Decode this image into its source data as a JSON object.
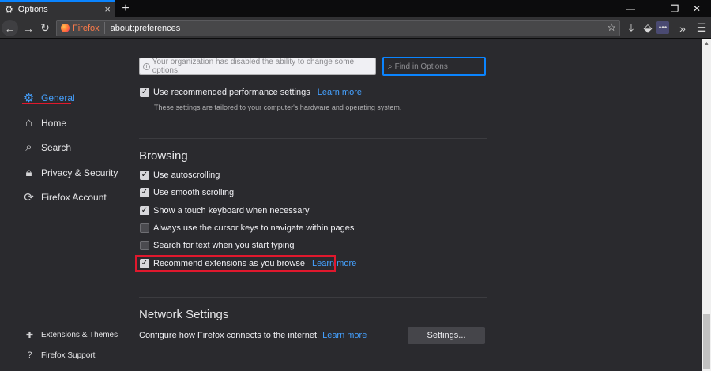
{
  "tab": {
    "title": "Options"
  },
  "navbar": {
    "identity_label": "Firefox",
    "url": "about:preferences"
  },
  "sidebar": {
    "categories": [
      {
        "label": "General"
      },
      {
        "label": "Home"
      },
      {
        "label": "Search"
      },
      {
        "label": "Privacy & Security"
      },
      {
        "label": "Firefox Account"
      }
    ],
    "footer": [
      {
        "label": "Extensions & Themes"
      },
      {
        "label": "Firefox Support"
      }
    ]
  },
  "policy_notice": "Your organization has disabled the ability to change some options.",
  "search": {
    "placeholder": "Find in Options"
  },
  "performance": {
    "label": "Use recommended performance settings",
    "link": "Learn more",
    "hint": "These settings are tailored to your computer's hardware and operating system.",
    "checked": true
  },
  "browsing": {
    "heading": "Browsing",
    "options": [
      {
        "label": "Use autoscrolling",
        "checked": true
      },
      {
        "label": "Use smooth scrolling",
        "checked": true
      },
      {
        "label": "Show a touch keyboard when necessary",
        "checked": true
      },
      {
        "label": "Always use the cursor keys to navigate within pages",
        "checked": false
      },
      {
        "label": "Search for text when you start typing",
        "checked": false
      },
      {
        "label": "Recommend extensions as you browse",
        "checked": true,
        "link": "Learn more"
      }
    ]
  },
  "network": {
    "heading": "Network Settings",
    "description": "Configure how Firefox connects to the internet.",
    "link": "Learn more",
    "button": "Settings..."
  },
  "colors": {
    "accent": "#0a84ff",
    "link": "#45a1ff",
    "highlight": "#e0182d",
    "background": "#2a2a2e"
  }
}
